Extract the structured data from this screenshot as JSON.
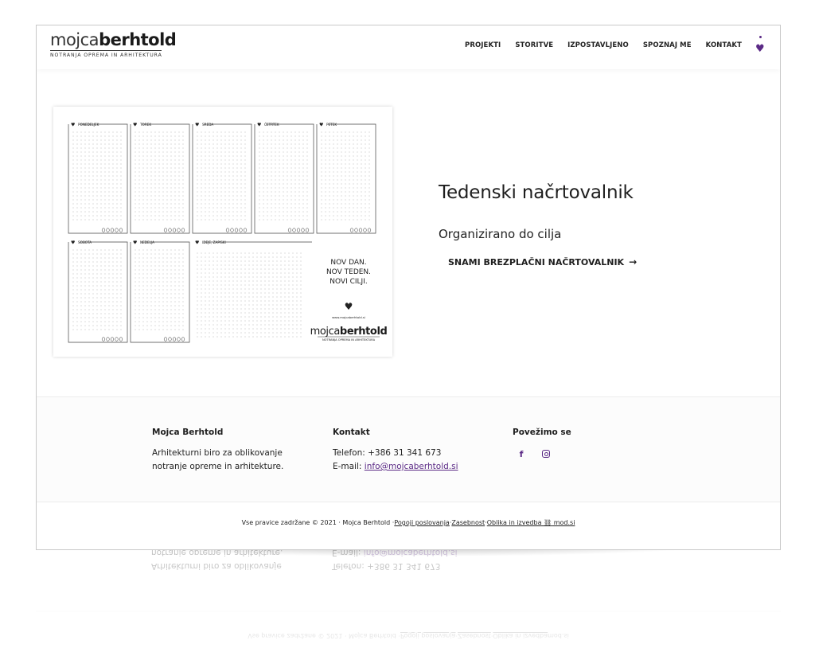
{
  "header": {
    "logo_light": "mojca",
    "logo_bold": "berhtold",
    "logo_sub": "NOTRANJA OPREMA IN ARHITEKTURA",
    "nav": [
      {
        "label": "PROJEKTI"
      },
      {
        "label": "STORITVE"
      },
      {
        "label": "IZPOSTAVLJENO"
      },
      {
        "label": "SPOZNAJ ME"
      },
      {
        "label": "KONTAKT"
      }
    ]
  },
  "planner": {
    "days_top": [
      "PONEDELJEK",
      "TOREK",
      "SREDA",
      "ČETRTEK",
      "PETEK"
    ],
    "days_bottom": [
      "SOBOTA",
      "NEDELJA",
      "IDEJE, ZAPISKI"
    ],
    "slogan": [
      "NOV DAN.",
      "NOV TEDEN.",
      "NOVI CILJI."
    ],
    "url": "www.mojcaberhtold.si",
    "logo_light": "mojca",
    "logo_bold": "berhtold",
    "logo_sub": "NOTRANJA OPREMA IN ARHITEKTURA"
  },
  "hero": {
    "title": "Tedenski načrtovalnik",
    "subtitle": "Organizirano do cilja",
    "cta": "SNAMI BREZPLAČNI NAČRTOVALNIK",
    "cta_arrow": "→"
  },
  "footer": {
    "col1": {
      "title": "Mojca Berhtold",
      "text": "Arhitekturni biro za oblikovanje notranje opreme in arhitekture."
    },
    "col2": {
      "title": "Kontakt",
      "phone": "Telefon: +386 31 341 673",
      "email_prefix": "E-mail: ",
      "email": "info@mojcaberhtold.si"
    },
    "col3": {
      "title": "Povežimo se",
      "facebook_glyph": "f"
    }
  },
  "copyright": {
    "text": "Vse pravice zadržane © 2021 · Mojca Berhtold · ",
    "link1": "Pogoji poslovanja",
    "sep1": " · ",
    "link2": "Zasebnost",
    "sep2": " · ",
    "link3": "Oblika in izvedba",
    "link4": " mod.si"
  },
  "colors": {
    "accent": "#5b2a86"
  }
}
